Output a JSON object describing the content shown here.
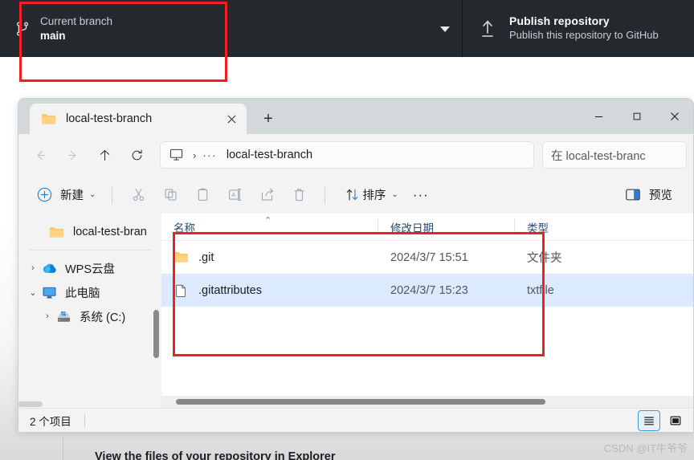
{
  "github_toolbar": {
    "branch": {
      "icon": "git-branch-icon",
      "label": "Current branch",
      "value": "main",
      "caret": "chevron-down-icon"
    },
    "publish": {
      "icon": "publish-upload-icon",
      "title": "Publish repository",
      "subtitle": "Publish this repository to GitHub"
    },
    "bg_color": "#24292e"
  },
  "github_body": {
    "bottom_heading": "View the files of your repository in Explorer",
    "watermark": "CSDN @IT牛爷爷"
  },
  "explorer": {
    "titlebar": {
      "tab": {
        "icon": "folder-icon",
        "label": "local-test-branch",
        "close": "×"
      },
      "new_tab": "+",
      "window_controls": {
        "minimize": "minimize-icon",
        "maximize": "maximize-icon",
        "close": "close-icon"
      }
    },
    "navbar": {
      "back": "back-arrow-icon",
      "forward": "forward-arrow-icon",
      "up": "up-arrow-icon",
      "refresh": "refresh-icon",
      "address": {
        "pc_icon": "this-pc-monitor-icon",
        "separator": "›",
        "overflow": "···",
        "path": "local-test-branch"
      },
      "search_placeholder": "在 local-test-branc"
    },
    "commandbar": {
      "new_label": "新建",
      "new_icon": "plus-circle-icon",
      "cut_icon": "scissors-icon",
      "copy_icon": "copy-icon",
      "paste_icon": "paste-icon",
      "rename_icon": "rename-icon",
      "share_icon": "share-icon",
      "delete_icon": "trash-icon",
      "sort_label": "排序",
      "sort_icon": "sort-arrows-icon",
      "more_label": "···",
      "preview_label": "预览",
      "preview_icon": "preview-pane-icon"
    },
    "sidebar": {
      "items": [
        {
          "label": "local-test-bran",
          "icon": "folder-icon",
          "chevron": "",
          "indent": 0
        },
        {
          "label": "WPS云盘",
          "icon": "cloud-icon",
          "chevron": "›",
          "indent": 0
        },
        {
          "label": "此电脑",
          "icon": "this-pc-monitor-icon",
          "chevron": "⌄",
          "indent": 0
        },
        {
          "label": "系统 (C:)",
          "icon": "drive-icon",
          "chevron": "›",
          "indent": 1
        }
      ]
    },
    "filelist": {
      "columns": [
        "名称",
        "修改日期",
        "类型"
      ],
      "sort_caret": "⌃",
      "rows": [
        {
          "name": ".git",
          "icon": "folder-icon",
          "date": "2024/3/7 15:51",
          "type": "文件夹",
          "selected": false
        },
        {
          "name": ".gitattributes",
          "icon": "file-icon",
          "date": "2024/3/7 15:23",
          "type": "txtfile",
          "selected": true
        }
      ]
    },
    "statusbar": {
      "item_count": "2 个项目",
      "view_details_icon": "details-view-icon",
      "view_large_icon": "large-icons-view-icon"
    }
  },
  "annotations": {
    "box_color": "#f02020",
    "boxes": [
      "current-branch-highlight",
      "file-list-highlight"
    ]
  }
}
